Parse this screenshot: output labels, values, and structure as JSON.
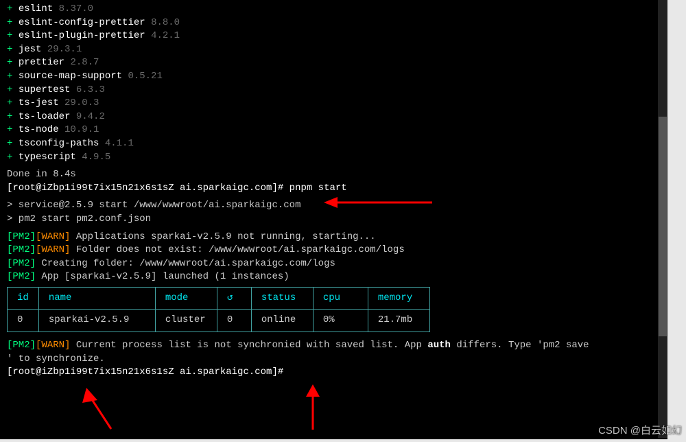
{
  "install": {
    "packages": [
      {
        "name": "eslint",
        "ver": "8.37.0"
      },
      {
        "name": "eslint-config-prettier",
        "ver": "8.8.0"
      },
      {
        "name": "eslint-plugin-prettier",
        "ver": "4.2.1"
      },
      {
        "name": "jest",
        "ver": "29.3.1"
      },
      {
        "name": "prettier",
        "ver": "2.8.7"
      },
      {
        "name": "source-map-support",
        "ver": "0.5.21"
      },
      {
        "name": "supertest",
        "ver": "6.3.3"
      },
      {
        "name": "ts-jest",
        "ver": "29.0.3"
      },
      {
        "name": "ts-loader",
        "ver": "9.4.2"
      },
      {
        "name": "ts-node",
        "ver": "10.9.1"
      },
      {
        "name": "tsconfig-paths",
        "ver": "4.1.1"
      },
      {
        "name": "typescript",
        "ver": "4.9.5"
      }
    ],
    "done": "Done in 8.4s"
  },
  "prompt": {
    "line1_prefix": "[root@iZbp1i99t7ix15n21x6s1sZ ai.sparkaigc.com]#",
    "line1_cmd": " pnpm start",
    "line2_prefix": "[root@iZbp1i99t7ix15n21x6s1sZ ai.sparkaigc.com]#",
    "line2_cmd": ""
  },
  "run": {
    "line1": "> service@2.5.9 start /www/wwwroot/ai.sparkaigc.com",
    "line2": "> pm2 start pm2.conf.json"
  },
  "pm2tags": {
    "pm2": "[PM2]",
    "warn": "[WARN]"
  },
  "pm2lines": {
    "warn1": " Applications sparkai-v2.5.9 not running, starting...",
    "warn2": " Folder does not exist: /www/wwwroot/ai.sparkaigc.com/logs",
    "info1": " Creating folder: /www/wwwroot/ai.sparkaigc.com/logs",
    "info2": " App [sparkai-v2.5.9] launched (1 instances)"
  },
  "table": {
    "headers": {
      "id": "id",
      "name": "name",
      "mode": "mode",
      "restart": "↻",
      "status": "status",
      "cpu": "cpu",
      "memory": "memory"
    },
    "row": {
      "id": "0",
      "name": "sparkai-v2.5.9",
      "mode": "cluster",
      "restart": "0",
      "status": "online",
      "cpu": "0%",
      "memory": "21.7mb"
    }
  },
  "postwarn": {
    "seg1": " Current process list is not synchroni",
    "seg2": "ed with saved list. App ",
    "auth": "auth",
    "seg3": " differs. Type 'pm2 save",
    "line2": "' to synchronize."
  },
  "watermark": "CSDN @白云如幻"
}
